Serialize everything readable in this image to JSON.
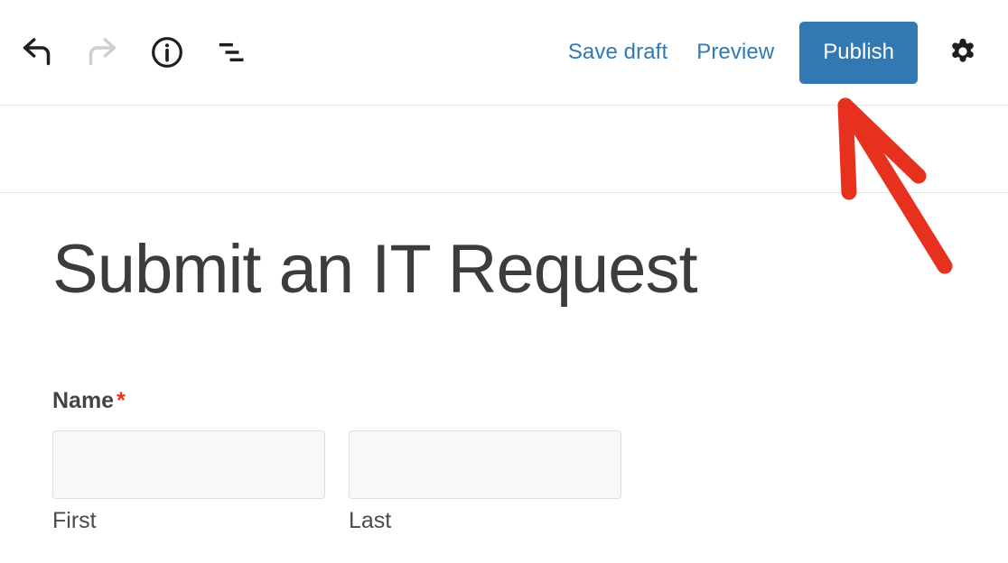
{
  "toolbar": {
    "left_tools": [
      {
        "name": "undo-icon",
        "label": "Undo",
        "state": "enabled"
      },
      {
        "name": "redo-icon",
        "label": "Redo",
        "state": "disabled"
      },
      {
        "name": "info-icon",
        "label": "Details"
      },
      {
        "name": "list-view-icon",
        "label": "List view"
      }
    ],
    "save_draft_label": "Save draft",
    "preview_label": "Preview",
    "publish_label": "Publish",
    "settings_icon_label": "Settings",
    "publish_button_color": "#3278b2",
    "link_color": "#2e7ab2"
  },
  "form": {
    "title": "Submit an IT Request",
    "fields": [
      {
        "label": "Name",
        "required_marker": "*",
        "required_color": "#e8301e",
        "subfields": [
          {
            "value": "",
            "placeholder": "",
            "sublabel": "First"
          },
          {
            "value": "",
            "placeholder": "",
            "sublabel": "Last"
          }
        ]
      }
    ]
  },
  "annotation": {
    "type": "arrow",
    "color": "#e8301e",
    "points_to": "publish-button"
  }
}
